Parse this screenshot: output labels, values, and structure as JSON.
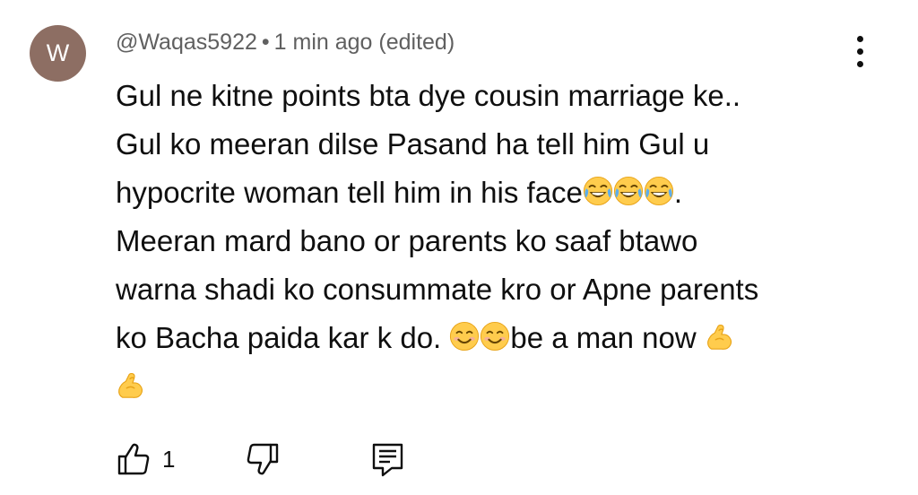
{
  "comment": {
    "avatar_letter": "W",
    "avatar_color": "#8d6e63",
    "author": "@Waqas5922",
    "separator": "•",
    "time": "1 min ago (edited)",
    "lines": [
      "Gul ne kitne points bta dye cousin marriage ke..",
      "Gul ko meeran dilse Pasand ha tell him Gul u",
      "hypocrite woman tell him in his face",
      ".",
      "Meeran mard bano or parents ko saaf btawo",
      "warna shadi ko consummate kro or Apne parents",
      "ko Bacha paida kar k do. ",
      "be a man now "
    ],
    "emojis": {
      "line3": [
        "face-with-tears-of-joy",
        "face-with-tears-of-joy",
        "face-with-tears-of-joy"
      ],
      "line6_mid": [
        "smiling-face-with-smiling-eyes",
        "smiling-face-with-smiling-eyes"
      ],
      "line6_end": [
        "flexed-biceps"
      ],
      "line7": [
        "flexed-biceps"
      ]
    }
  },
  "actions": {
    "like_icon": "thumbs-up-icon",
    "like_count": "1",
    "dislike_icon": "thumbs-down-icon",
    "reply_icon": "reply-icon",
    "menu_icon": "more-vertical-icon"
  }
}
